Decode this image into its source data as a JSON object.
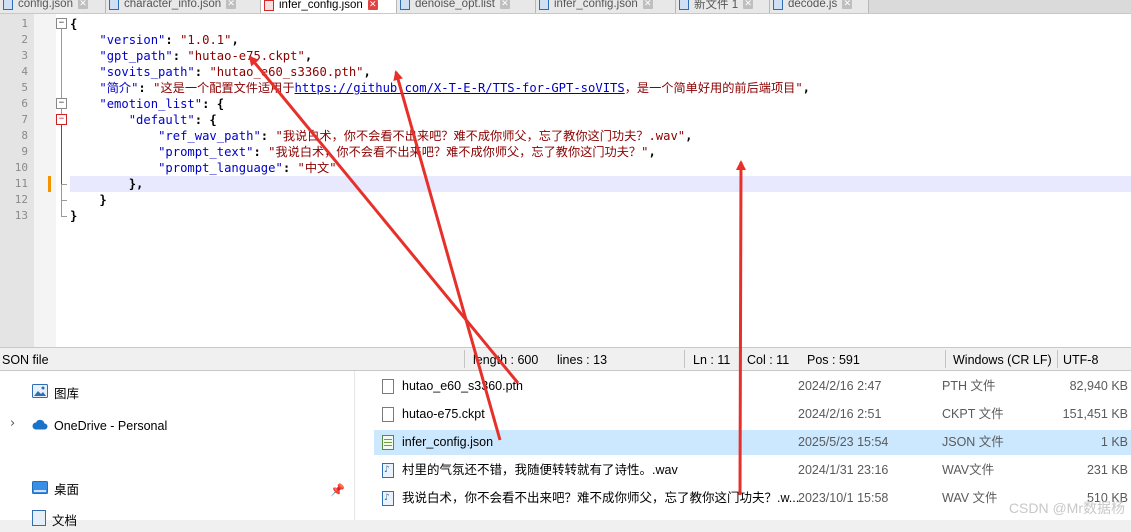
{
  "tabs": [
    {
      "label": "config.json",
      "active": false
    },
    {
      "label": "character_info.json",
      "active": false
    },
    {
      "label": "infer_config.json",
      "active": true
    },
    {
      "label": "denoise_opt.list",
      "active": false
    },
    {
      "label": "infer_config.json",
      "active": false
    },
    {
      "label": "新文件 1",
      "active": false
    },
    {
      "label": "decode.js",
      "active": false
    }
  ],
  "editor": {
    "line_numbers": [
      "1",
      "2",
      "3",
      "4",
      "5",
      "6",
      "7",
      "8",
      "9",
      "10",
      "11",
      "12",
      "13"
    ],
    "lines": {
      "l1_brace": "{",
      "l2_key": "\"version\"",
      "l2_val": "\"1.0.1\"",
      "l3_key": "\"gpt_path\"",
      "l3_val": "\"hutao-e75.ckpt\"",
      "l4_key": "\"sovits_path\"",
      "l4_val": "\"hutao_e60_s3360.pth\"",
      "l5_key": "\"简介\"",
      "l5_val_pre": "\"这是一个配置文件适用于",
      "l5_url": "https://github.com/X-T-E-R/TTS-for-GPT-soVITS",
      "l5_val_post": "，是一个简单好用的前后端项目\"",
      "l6_key": "\"emotion_list\"",
      "l7_key": "\"default\"",
      "l8_key": "\"ref_wav_path\"",
      "l8_val": "\"我说白术，你不会看不出来吧？难不成你师父，忘了教你这门功夫？.wav\"",
      "l9_key": "\"prompt_text\"",
      "l9_val": "\"我说白术，你不会看不出来吧？难不成你师父，忘了教你这门功夫？\"",
      "l10_key": "\"prompt_language\"",
      "l10_val": "\"中文\"",
      "l11_close": "},",
      "l12_close": "}",
      "l13_close": "}"
    }
  },
  "status": {
    "file_type": "SON file",
    "length": "length : 600",
    "lines": "lines : 13",
    "ln": "Ln : 11",
    "col": "Col : 11",
    "pos": "Pos : 591",
    "eol": "Windows (CR LF)",
    "encoding": "UTF-8"
  },
  "nav": {
    "gallery": "图库",
    "onedrive": "OneDrive - Personal",
    "desktop": "桌面",
    "documents": "文档"
  },
  "files": [
    {
      "name": "hutao_e60_s3360.pth",
      "date": "2024/2/16 2:47",
      "type": "PTH 文件",
      "size": "82,940 KB",
      "icon": "file-icon",
      "selected": false
    },
    {
      "name": "hutao-e75.ckpt",
      "date": "2024/2/16 2:51",
      "type": "CKPT 文件",
      "size": "151,451 KB",
      "icon": "file-icon",
      "selected": false
    },
    {
      "name": "infer_config.json",
      "date": "2025/5/23 15:54",
      "type": "JSON 文件",
      "size": "1 KB",
      "icon": "json-file-icon",
      "selected": true
    },
    {
      "name": "村里的气氛还不错，我随便转转就有了诗性。.wav",
      "date": "2024/1/31 23:16",
      "type": "WAV文件",
      "size": "231 KB",
      "icon": "audio-file-icon",
      "selected": false
    },
    {
      "name": "我说白术，你不会看不出来吧？难不成你师父，忘了教你这门功夫？.w...",
      "date": "2023/10/1 15:58",
      "type": "WAV 文件",
      "size": "510 KB",
      "icon": "audio-file-icon",
      "selected": false
    }
  ],
  "watermark": "CSDN @Mr数据杨",
  "colors": {
    "annotation_arrow": "#e8302a",
    "selection": "#cce8ff",
    "active_tab_accent": "#f29400"
  }
}
